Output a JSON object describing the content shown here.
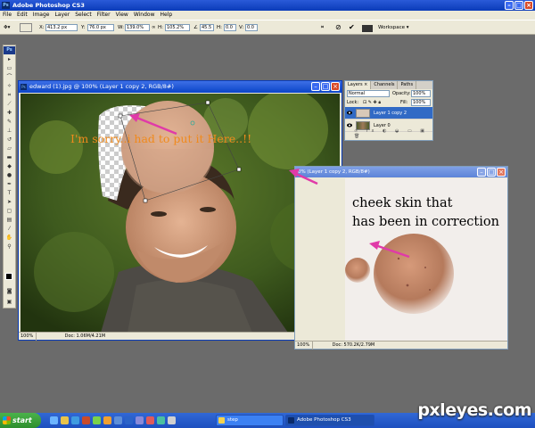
{
  "app": {
    "title": "Adobe Photoshop CS3",
    "menu": [
      "File",
      "Edit",
      "Image",
      "Layer",
      "Select",
      "Filter",
      "View",
      "Window",
      "Help"
    ]
  },
  "options_bar": {
    "x_label": "X:",
    "x_value": "413.2 px",
    "y_label": "Y:",
    "y_value": "76.0 px",
    "w_label": "W:",
    "w_value": "139.0%",
    "h_label": "H:",
    "h_value": "105.2%",
    "rotate_value": "45.5",
    "h_skew_label": "H:",
    "h_skew_value": "0.0",
    "v_skew_label": "V:",
    "v_skew_value": "0.0",
    "workspace_label": "Workspace ▾"
  },
  "document1": {
    "title": "edward (1).jpg @ 100% (Layer 1 copy 2, RGB/8#)",
    "overlay_text": "I'm sorry..i had to put it Here..!!",
    "zoom": "100%",
    "status": "Doc: 1.06M/4.21M"
  },
  "layers_panel": {
    "tabs": [
      "Layers ×",
      "Channels",
      "Paths"
    ],
    "blend_mode": "Normal",
    "opacity_label": "Opacity:",
    "opacity_value": "100%",
    "lock_label": "Lock:",
    "fill_label": "Fill:",
    "fill_value": "100%",
    "layers": [
      {
        "name": "Layer 1 copy 2",
        "selected": true
      },
      {
        "name": "Layer 0",
        "selected": false
      }
    ]
  },
  "document2": {
    "title": "0% (Layer 1 copy 2, RGB/8#)",
    "annotation_line1": "cheek skin that",
    "annotation_line2": "has been in correction",
    "zoom": "100%",
    "status": "Doc: 570.2K/2.79M"
  },
  "taskbar": {
    "start_label": "start",
    "tasks": [
      "step",
      "Adobe Photoshop CS3"
    ]
  },
  "watermark": "pxleyes.com",
  "colors": {
    "annotation_text": "#f08a1c",
    "arrow": "#e03aa8",
    "selection": "#316ac5"
  }
}
